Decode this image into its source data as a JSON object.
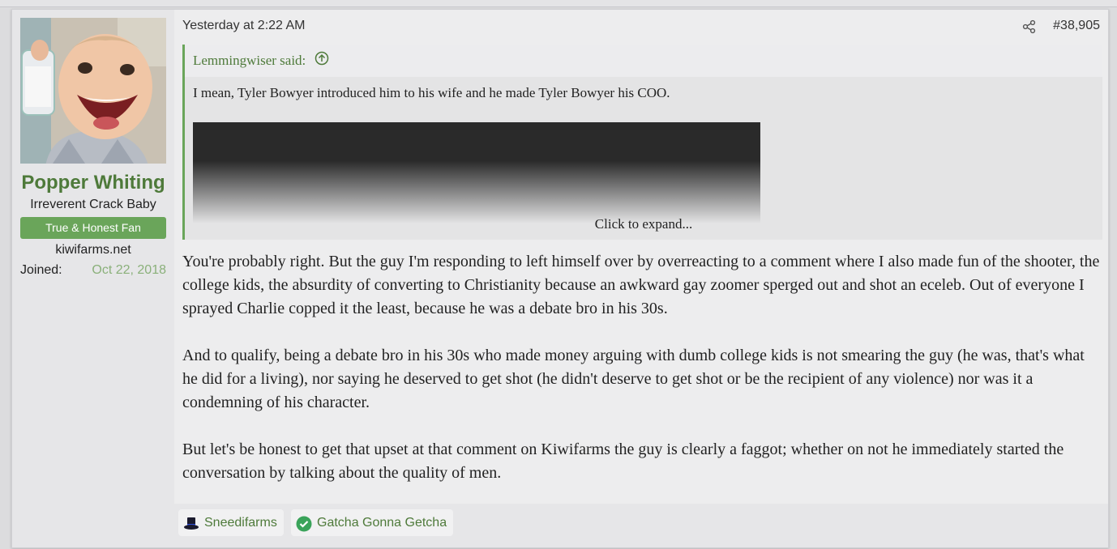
{
  "user": {
    "name": "Popper Whiting",
    "title": "Irreverent Crack Baby",
    "banner": "True & Honest Fan",
    "site": "kiwifarms.net",
    "joined_label": "Joined:",
    "joined_value": "Oct 22, 2018"
  },
  "post": {
    "time": "Yesterday at 2:22 AM",
    "number": "#38,905",
    "share_icon": "share-icon"
  },
  "quote": {
    "author": "Lemmingwiser said:",
    "text": "I mean, Tyler Bowyer introduced him to his wife and he made Tyler Bowyer his COO.",
    "expand": "Click to expand..."
  },
  "body": {
    "p1": "You're probably right. But the guy I'm responding to left himself over by overreacting to a comment where I also made fun of the shooter, the college kids, the absurdity of converting to Christianity because an awkward gay zoomer sperged out and shot an eceleb. Out of everyone I sprayed Charlie copped it the least, because he was a debate bro in his 30s.",
    "p2": "And to qualify, being a debate bro in his 30s who made money arguing with dumb college kids is not smearing the guy (he was, that's what he did for a living), nor saying he deserved to get shot (he didn't deserve to get shot or be the recipient of any violence) nor was it a condemning of his character.",
    "p3": "But let's be honest to get that upset at that comment on Kiwifarms the guy is clearly a faggot; whether on not he immediately started the conversation by talking about the quality of men."
  },
  "reactions": [
    {
      "label": "Sneedifarms",
      "icon": "top-hat-icon"
    },
    {
      "label": "Gatcha Gonna Getcha",
      "icon": "check-circle-icon"
    }
  ],
  "colors": {
    "accent": "#4e7a3a",
    "banner": "#6aa55a",
    "joined_date": "#8ab07a"
  }
}
